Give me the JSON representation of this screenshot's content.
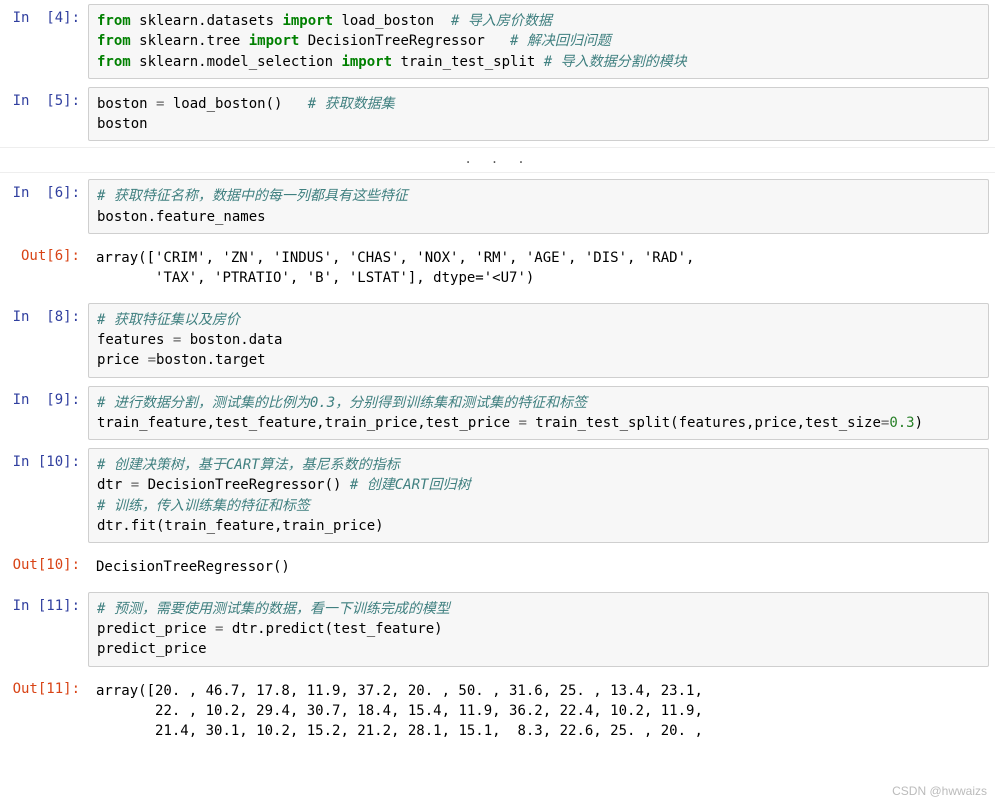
{
  "cells": {
    "c4": {
      "prompt": "In  [4]:",
      "line1": {
        "kw1": "from",
        "mod": " sklearn.datasets ",
        "kw2": "import",
        "name": " load_boston  ",
        "comment": "# 导入房价数据"
      },
      "line2": {
        "kw1": "from",
        "mod": " sklearn.tree ",
        "kw2": "import",
        "name": " DecisionTreeRegressor   ",
        "comment": "# 解决回归问题"
      },
      "line3": {
        "kw1": "from",
        "mod": " sklearn.model_selection ",
        "kw2": "import",
        "name": " train_test_split ",
        "comment": "# 导入数据分割的模块"
      }
    },
    "c5": {
      "prompt": "In  [5]:",
      "line1": {
        "text": "boston ",
        "op": "=",
        "rest": " load_boston()   ",
        "comment": "# 获取数据集"
      },
      "line2": "boston"
    },
    "ellipsis": ". . .",
    "c6": {
      "prompt": "In  [6]:",
      "line1": {
        "comment": "# 获取特征名称，数据中的每一列都具有这些特征"
      },
      "line2": "boston.feature_names"
    },
    "o6": {
      "prompt": "Out[6]:",
      "text": "array(['CRIM', 'ZN', 'INDUS', 'CHAS', 'NOX', 'RM', 'AGE', 'DIS', 'RAD',\n       'TAX', 'PTRATIO', 'B', 'LSTAT'], dtype='<U7')"
    },
    "c8": {
      "prompt": "In  [8]:",
      "line1": {
        "comment": "# 获取特征集以及房价"
      },
      "line2": {
        "a": "features ",
        "op": "=",
        "b": " boston.data"
      },
      "line3": {
        "a": "price ",
        "op": "=",
        "b": "boston.target"
      }
    },
    "c9": {
      "prompt": "In  [9]:",
      "line1": {
        "comment": "# 进行数据分割，测试集的比例为0.3，分别得到训练集和测试集的特征和标签"
      },
      "line2": {
        "lhs": "train_feature,test_feature,train_price,test_price ",
        "op": "=",
        "mid": " train_test_split(features,price,test_size",
        "op2": "=",
        "num": "0.3",
        "tail": ")"
      }
    },
    "c10": {
      "prompt": "In [10]:",
      "line1": {
        "comment": "# 创建决策树，基于CART算法，基尼系数的指标"
      },
      "line2": {
        "a": "dtr ",
        "op": "=",
        "b": " DecisionTreeRegressor() ",
        "comment": "# 创建CART回归树"
      },
      "line3": {
        "comment": "# 训练，传入训练集的特征和标签"
      },
      "line4": "dtr.fit(train_feature,train_price)"
    },
    "o10": {
      "prompt": "Out[10]:",
      "text": "DecisionTreeRegressor()"
    },
    "c11": {
      "prompt": "In [11]:",
      "line1": {
        "comment": "# 预测，需要使用测试集的数据，看一下训练完成的模型"
      },
      "line2": {
        "a": "predict_price ",
        "op": "=",
        "b": " dtr.predict(test_feature)"
      },
      "line3": "predict_price"
    },
    "o11": {
      "prompt": "Out[11]:",
      "text": "array([20. , 46.7, 17.8, 11.9, 37.2, 20. , 50. , 31.6, 25. , 13.4, 23.1,\n       22. , 10.2, 29.4, 30.7, 18.4, 15.4, 11.9, 36.2, 22.4, 10.2, 11.9,\n       21.4, 30.1, 10.2, 15.2, 21.2, 28.1, 15.1,  8.3, 22.6, 25. , 20. ,"
    }
  },
  "watermark": "CSDN @hwwaizs"
}
